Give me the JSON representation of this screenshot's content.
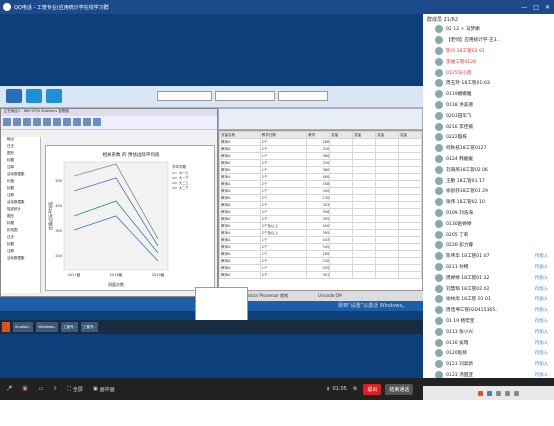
{
  "app": {
    "title": "QQ电话 - 工管专业(应用统计学在线学习群",
    "window_controls": [
      "—",
      "□",
      "✕"
    ]
  },
  "spss": {
    "window_title": "正在输出1 - IBM SPSS Statistics 查看器",
    "tree_items": [
      "输出",
      "日志",
      "图形",
      "标题",
      "注释",
      "活动数据集",
      "均值",
      "标题",
      "注释",
      "活动数据集",
      "描述统计",
      "图形",
      "标题",
      "折线图",
      "日志",
      "标题",
      "注释",
      "活动数据集"
    ],
    "chart_title": "相关系数 的 预估边际平均值",
    "x_label": "测量次数",
    "y_label": "估算边际平均值",
    "x_ticks": [
      "2017届",
      "2018届",
      "2019届"
    ],
    "y_ticks": [
      "500",
      "400",
      "300",
      "200"
    ],
    "legend_title": "学年学期",
    "legend": [
      "大一上",
      "大一下",
      "大二上",
      "大二下"
    ],
    "data_header": [
      "变量名称",
      "教学日期",
      "教学",
      "变量",
      "变量",
      "变量",
      "变量"
    ],
    "rows": [
      [
        "教师A",
        "2个",
        "260"
      ],
      [
        "教师A",
        "2个",
        "320"
      ],
      [
        "教师A",
        "1个",
        "360"
      ],
      [
        "教师A",
        "2个",
        "330"
      ],
      [
        "教师A",
        "1个",
        "380"
      ],
      [
        "教师A",
        "2个",
        "480"
      ],
      [
        "教师A",
        "2个",
        "358"
      ],
      [
        "教师A",
        "1个",
        "345"
      ],
      [
        "教师A",
        "2个",
        "230"
      ],
      [
        "教师A",
        "2个",
        "303"
      ],
      [
        "教师A",
        "2个",
        "356"
      ],
      [
        "教师A",
        "2个",
        "395"
      ],
      [
        "教师A",
        "2个及以上",
        "400"
      ],
      [
        "教师A",
        "2个及以上",
        "395"
      ],
      [
        "教师A",
        "1个",
        "403"
      ],
      [
        "教师A",
        "2个",
        "345"
      ],
      [
        "教师A",
        "1个",
        "285"
      ],
      [
        "教师A",
        "2个",
        "230"
      ],
      [
        "教师A",
        "1个",
        "320"
      ],
      [
        "教师A",
        "2个",
        "301"
      ]
    ],
    "status_left": "IBM SPSS Statistics Processor 就绪",
    "status_right": "Unicode:ON"
  },
  "windows_watermark": [
    "激活 Windows",
    "转到“设置”以激活 Windows。"
  ],
  "taskbar_items": [
    "StudioLi..",
    "Windows..",
    "工管专..",
    "工管专.."
  ],
  "members": {
    "header": "群成员 21/62",
    "list": [
      {
        "name": "02 12 + 马梦娜",
        "status": "",
        "red": false
      },
      {
        "name": "【老师】应用统计学-王3..",
        "status": "",
        "red": false
      },
      {
        "name": "陈兴 18工管02 01",
        "status": "",
        "red": true
      },
      {
        "name": "李维工管0126",
        "status": "",
        "red": true
      },
      {
        "name": "0125马小晓",
        "status": "",
        "red": true
      },
      {
        "name": "周玉玲-18工管01-03",
        "status": "",
        "red": false
      },
      {
        "name": "0119娜娜雅",
        "status": "",
        "red": false
      },
      {
        "name": "0118 洪美德",
        "status": "",
        "red": false
      },
      {
        "name": "0203田华飞",
        "status": "",
        "red": false
      },
      {
        "name": "0216 李佳楠",
        "status": "",
        "red": false
      },
      {
        "name": "0222殷梓",
        "status": "",
        "red": false
      },
      {
        "name": "何秋枝18工管0127",
        "status": "",
        "red": false
      },
      {
        "name": "0124 韩媛媛",
        "status": "",
        "red": false
      },
      {
        "name": "刘海燕18工管02 06",
        "status": "",
        "red": false
      },
      {
        "name": "王鹏 18工管01 17",
        "status": "",
        "red": false
      },
      {
        "name": "徐舒舒18工管01 29",
        "status": "",
        "red": false
      },
      {
        "name": "张伟 18工管02 10",
        "status": "",
        "red": false
      },
      {
        "name": "0109 刘浩海",
        "status": "",
        "red": false
      },
      {
        "name": "0130赵婷婷",
        "status": "",
        "red": false
      },
      {
        "name": "0205 丁莉",
        "status": "",
        "red": false
      },
      {
        "name": "0226-彭力睿",
        "status": "",
        "red": false
      },
      {
        "name": "陈伟华 18工管01 07",
        "status": "待加入",
        "red": false
      },
      {
        "name": "0211 孙畅",
        "status": "待加入",
        "red": false
      },
      {
        "name": "周婷婷 18工管01 32",
        "status": "待加入",
        "red": false
      },
      {
        "name": "刘慧琦 18工管02 02",
        "status": "待加入",
        "red": false
      },
      {
        "name": "徐林高 18工管 01 01",
        "status": "待加入",
        "red": false
      },
      {
        "name": "周佳坤工管020415365..",
        "status": "待加入",
        "red": false
      },
      {
        "name": "01 19 杨宏宝",
        "status": "待加入",
        "red": false
      },
      {
        "name": "0113 张小兴",
        "status": "待加入",
        "red": false
      },
      {
        "name": "0116 侯瑞",
        "status": "待加入",
        "red": false
      },
      {
        "name": "0120赵菲",
        "status": "待加入",
        "red": false
      },
      {
        "name": "0123 刘高新",
        "status": "待加入",
        "red": false
      },
      {
        "name": "0123 汤国亚",
        "status": "待加入",
        "red": false
      }
    ]
  },
  "bottom": {
    "fullscreen": "全屏",
    "pip": "画中画",
    "time": "01:05",
    "leave": "退出",
    "end": "结束通话"
  }
}
